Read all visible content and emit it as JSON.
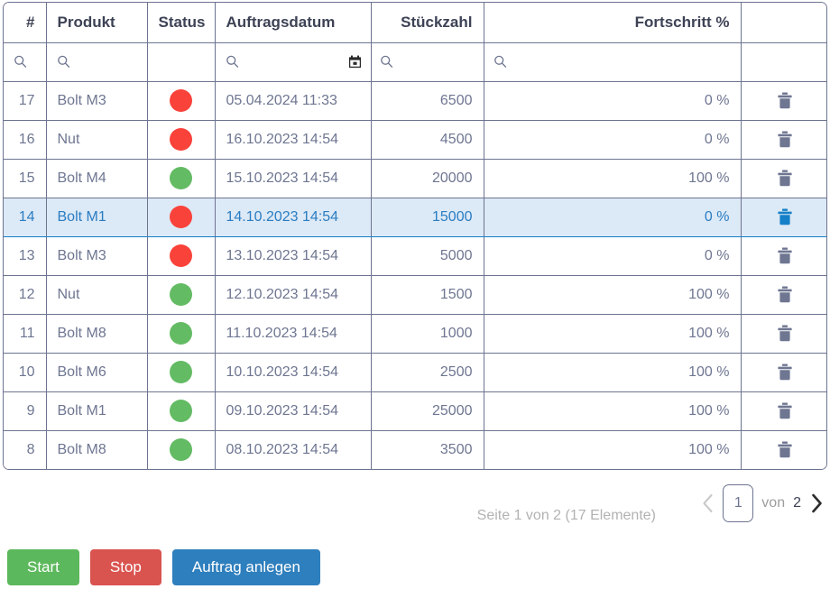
{
  "table": {
    "columns": [
      {
        "key": "id",
        "label": "#"
      },
      {
        "key": "product",
        "label": "Produkt"
      },
      {
        "key": "status",
        "label": "Status"
      },
      {
        "key": "date",
        "label": "Auftragsdatum"
      },
      {
        "key": "quantity",
        "label": "Stückzahl"
      },
      {
        "key": "progress",
        "label": "Fortschritt %"
      },
      {
        "key": "actions",
        "label": ""
      }
    ],
    "filters": {
      "id_icon": "search-icon",
      "product_icon": "search-icon",
      "date_icon": "search-icon",
      "date_calendar_icon": "calendar-icon",
      "quantity_icon": "search-icon",
      "progress_icon": "search-icon",
      "id_value": "",
      "product_value": "",
      "date_value": "",
      "quantity_value": "",
      "progress_value": ""
    },
    "rows": [
      {
        "id": "17",
        "product": "Bolt M3",
        "status": "red",
        "date": "05.04.2024 11:33",
        "quantity": "6500",
        "progress": "0 %",
        "action_icon": "trash-icon",
        "selected": false
      },
      {
        "id": "16",
        "product": "Nut",
        "status": "red",
        "date": "16.10.2023 14:54",
        "quantity": "4500",
        "progress": "0 %",
        "action_icon": "trash-icon",
        "selected": false
      },
      {
        "id": "15",
        "product": "Bolt M4",
        "status": "green",
        "date": "15.10.2023 14:54",
        "quantity": "20000",
        "progress": "100 %",
        "action_icon": "trash-icon",
        "selected": false
      },
      {
        "id": "14",
        "product": "Bolt M1",
        "status": "red",
        "date": "14.10.2023 14:54",
        "quantity": "15000",
        "progress": "0 %",
        "action_icon": "trash-icon",
        "selected": true
      },
      {
        "id": "13",
        "product": "Bolt M3",
        "status": "red",
        "date": "13.10.2023 14:54",
        "quantity": "5000",
        "progress": "0 %",
        "action_icon": "trash-icon",
        "selected": false
      },
      {
        "id": "12",
        "product": "Nut",
        "status": "green",
        "date": "12.10.2023 14:54",
        "quantity": "1500",
        "progress": "100 %",
        "action_icon": "trash-icon",
        "selected": false
      },
      {
        "id": "11",
        "product": "Bolt M8",
        "status": "green",
        "date": "11.10.2023 14:54",
        "quantity": "1000",
        "progress": "100 %",
        "action_icon": "trash-icon",
        "selected": false
      },
      {
        "id": "10",
        "product": "Bolt M6",
        "status": "green",
        "date": "10.10.2023 14:54",
        "quantity": "2500",
        "progress": "100 %",
        "action_icon": "trash-icon",
        "selected": false
      },
      {
        "id": "9",
        "product": "Bolt M1",
        "status": "green",
        "date": "09.10.2023 14:54",
        "quantity": "25000",
        "progress": "100 %",
        "action_icon": "trash-icon",
        "selected": false
      },
      {
        "id": "8",
        "product": "Bolt M8",
        "status": "green",
        "date": "08.10.2023 14:54",
        "quantity": "3500",
        "progress": "100 %",
        "action_icon": "trash-icon",
        "selected": false
      }
    ]
  },
  "pagination": {
    "info": "Seite 1 von 2 (17 Elemente)",
    "prev_icon": "chevron-left-icon",
    "next_icon": "chevron-right-icon",
    "current_page": "1",
    "of_label": "von",
    "total_pages": "2"
  },
  "buttons": {
    "start": "Start",
    "stop": "Stop",
    "create": "Auftrag anlegen"
  },
  "colors": {
    "status_red": "#f9423a",
    "status_green": "#63bb63",
    "selected_row_bg": "#dce9f6",
    "selected_row_text": "#2a7dc2",
    "selected_trash": "#1580c8",
    "border": "#6d7490",
    "text": "#6e7691",
    "header_text": "#3d4255",
    "btn_start": "#5cb85c",
    "btn_stop": "#d9534f",
    "btn_create": "#2e7fbd"
  }
}
